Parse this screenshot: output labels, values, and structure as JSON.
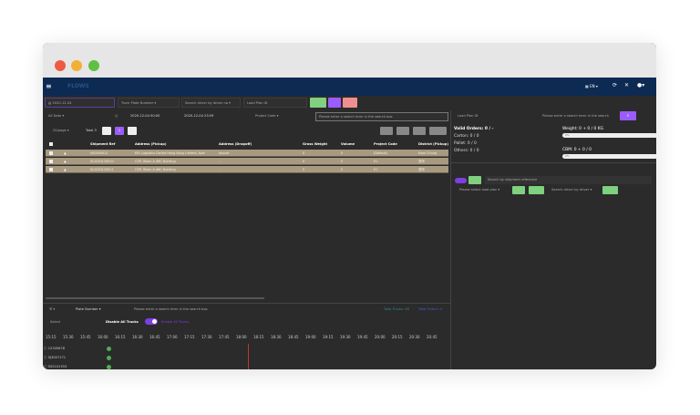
{
  "window": {
    "traffic_lights": [
      "#ee5b45",
      "#f2b035",
      "#5fc043"
    ]
  },
  "header": {
    "logo": "FLOWS",
    "lang": "EN",
    "icons": [
      "menu-icon",
      "flag-icon",
      "refresh-icon",
      "fullscreen-icon",
      "user-icon"
    ]
  },
  "toolbar": {
    "date": "2020-12-04",
    "truck_placeholder": "Truck Plate Number",
    "driver_placeholder": "Search driver by driver na",
    "loadplan_placeholder": "Load Plan ID"
  },
  "filters": {
    "data_select": "All Data",
    "start": "2020-12-04 00:00",
    "end": "2020-12-04 23:59",
    "project_select": "Project Code",
    "search_placeholder": "Please enter a search term in the search box",
    "per_page": "20/page",
    "total": "Total 3",
    "page": "1"
  },
  "table": {
    "columns": [
      "Shipment Ref",
      "Address (Pickup)",
      "Address (Dropoff)",
      "Gross Weight",
      "Volume",
      "Project Code",
      "District (Pickup)"
    ],
    "rows": [
      [
        "000000012",
        "KPL Logistics Centre Hong Kong Limited, Kow",
        "airport",
        "0",
        "0",
        "(Default)",
        "Kwai Chung"
      ],
      [
        "SL2020120010",
        "CGP, Block A ABC Building",
        "-",
        "0",
        "0",
        "91",
        "荃灣"
      ],
      [
        "SL2020120011",
        "CGP, Block A ABC Building",
        "-",
        "0",
        "0",
        "91",
        "荃灣"
      ]
    ]
  },
  "right": {
    "loadplan_placeholder": "Load Plan ID",
    "search_placeholder": "Please enter a search term in the search",
    "valid_orders": "Valid Orders: 0 / -",
    "carton": "Carton: 0 / 0",
    "pallet": "Pallet: 0 / 0",
    "others": "Others: 0 / 0",
    "weight": "Weight: 0 + 0 / 0 KG",
    "weight_pct": "0%",
    "cbm": "CBM: 0 + 0 / 0",
    "cbm_pct": "0%",
    "shipment_search": "Search by shipment reference",
    "select_loadplan": "Please select load plan",
    "driver_search": "Search driver by driver"
  },
  "bottom": {
    "plate_select": "Plate Number",
    "search_placeholder": "Please enter a search term in the search box",
    "total_trucks": "Total Trucks: 26",
    "total_orders": "Total Orders: 0",
    "select": "Select",
    "disable_label": "Disable All Trucks",
    "disable_on": true,
    "enable_label": "Enable All Trucks",
    "times": [
      "15:15",
      "15:30",
      "15:45",
      "16:00",
      "16:15",
      "16:30",
      "16:45",
      "17:00",
      "17:15",
      "17:30",
      "17:45",
      "18:00",
      "18:15",
      "18:30",
      "18:45",
      "19:00",
      "19:15",
      "19:30",
      "19:45",
      "20:00",
      "20:15",
      "20:30",
      "20:45"
    ],
    "trucks": [
      "12345678",
      "SJ3007171",
      "SS5101553"
    ]
  },
  "colors": {
    "header": "#0d2a52",
    "accent": "#9b5cff",
    "row": "#a89a80",
    "green": "#7fd07f",
    "now_line": "#c0392b"
  }
}
